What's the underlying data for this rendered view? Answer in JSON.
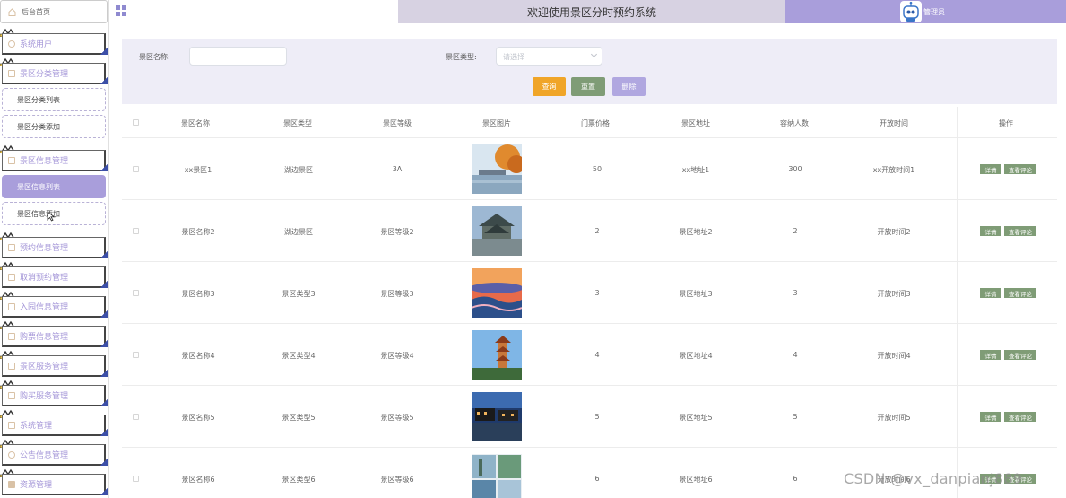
{
  "header": {
    "title": "欢迎使用景区分时预约系统",
    "user_name": "管理员",
    "colors": {
      "accent": "#a99edb",
      "title_bg": "#d7d2e2"
    }
  },
  "sidebar": {
    "home": {
      "label": "后台首页",
      "icon": "home-icon"
    },
    "menus": [
      {
        "label": "系统用户",
        "icon": "user-icon"
      },
      {
        "label": "景区分类管理",
        "icon": "doc-icon"
      },
      {
        "label": "景区信息管理",
        "icon": "doc-icon"
      },
      {
        "label": "预约信息管理",
        "icon": "doc-icon"
      },
      {
        "label": "取消预约管理",
        "icon": "doc-icon"
      },
      {
        "label": "入园信息管理",
        "icon": "doc-icon"
      },
      {
        "label": "购票信息管理",
        "icon": "doc-icon"
      },
      {
        "label": "景区服务管理",
        "icon": "doc-icon"
      },
      {
        "label": "购买服务管理",
        "icon": "doc-icon"
      },
      {
        "label": "系统管理",
        "icon": "doc-icon"
      },
      {
        "label": "公告信息管理",
        "icon": "info-icon"
      },
      {
        "label": "资源管理",
        "icon": "heart-icon"
      }
    ],
    "submenus": {
      "category": [
        "景区分类列表",
        "景区分类添加"
      ],
      "scenic": [
        "景区信息列表",
        "景区信息添加"
      ]
    },
    "active_submenu": "景区信息列表"
  },
  "search": {
    "name_label": "景区名称:",
    "name_value": "",
    "type_label": "景区类型:",
    "type_placeholder": "请选择",
    "query_label": "查询",
    "reset_label": "重置",
    "delete_label": "删除"
  },
  "table": {
    "columns": [
      "景区名称",
      "景区类型",
      "景区等级",
      "景区图片",
      "门票价格",
      "景区地址",
      "容纳人数",
      "开放时间",
      "操作"
    ],
    "rows": [
      {
        "name": "xx景区1",
        "type": "湖边景区",
        "level": "3A",
        "price": "50",
        "address": "xx地址1",
        "capacity": "300",
        "open_time": "xx开放时间1"
      },
      {
        "name": "景区名称2",
        "type": "湖边景区",
        "level": "景区等级2",
        "price": "2",
        "address": "景区地址2",
        "capacity": "2",
        "open_time": "开放时间2"
      },
      {
        "name": "景区名称3",
        "type": "景区类型3",
        "level": "景区等级3",
        "price": "3",
        "address": "景区地址3",
        "capacity": "3",
        "open_time": "开放时间3"
      },
      {
        "name": "景区名称4",
        "type": "景区类型4",
        "level": "景区等级4",
        "price": "4",
        "address": "景区地址4",
        "capacity": "4",
        "open_time": "开放时间4"
      },
      {
        "name": "景区名称5",
        "type": "景区类型5",
        "level": "景区等级5",
        "price": "5",
        "address": "景区地址5",
        "capacity": "5",
        "open_time": "开放时间5"
      },
      {
        "name": "景区名称6",
        "type": "景区类型6",
        "level": "景区等级6",
        "price": "6",
        "address": "景区地址6",
        "capacity": "6",
        "open_time": "开放时间6"
      }
    ],
    "actions": {
      "detail": "详情",
      "comment": "查看评论"
    }
  },
  "watermark": "CSDN @vx_danpianj889"
}
